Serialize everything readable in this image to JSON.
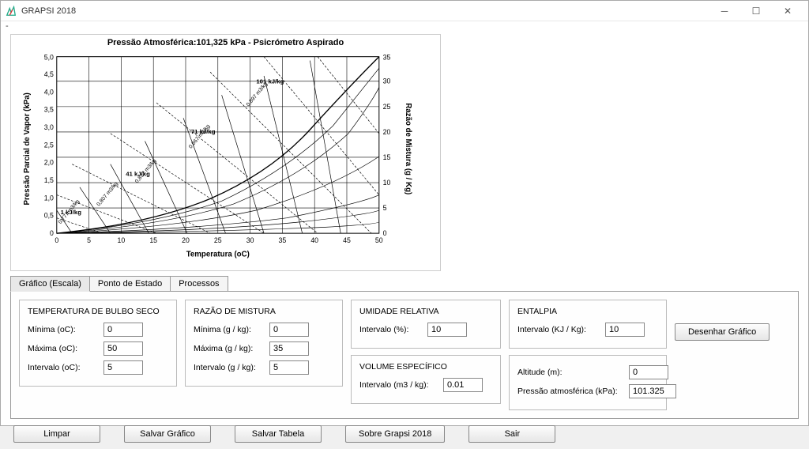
{
  "window": {
    "title": "GRAPSI 2018",
    "menubar_item": "-"
  },
  "chart_data": {
    "type": "area",
    "title": "Pressão Atmosférica:101,325 kPa - Psicrómetro Aspirado",
    "xlabel": "Temperatura (oC)",
    "ylabel_left": "Pressão Parcial de Vapor (kPa)",
    "ylabel_right": "Razão de Mistura (g / Kg)",
    "x_ticks": [
      0,
      5,
      10,
      15,
      20,
      25,
      30,
      35,
      40,
      45,
      50
    ],
    "y_left_ticks": [
      0,
      0.5,
      1.0,
      1.5,
      2.0,
      2.5,
      3.0,
      3.5,
      4.0,
      4.5,
      5.0
    ],
    "y_right_ticks": [
      0,
      5,
      10,
      15,
      20,
      25,
      30,
      35
    ],
    "enthalpy_lines_kJ_per_kg": [
      1,
      41,
      71,
      101
    ],
    "specific_volume_lines_m3_per_kg": [
      0.777,
      0.807,
      0.837,
      0.867,
      0.897
    ],
    "relative_humidity_lines_pct": [
      10,
      20,
      30,
      40,
      50,
      60,
      70,
      80,
      90,
      100
    ],
    "xlim": [
      0,
      50
    ],
    "ylim_left": [
      0,
      5.0
    ],
    "ylim_right": [
      0,
      35
    ]
  },
  "tabs": {
    "items": [
      {
        "label": "Gráfico (Escala)",
        "active": true
      },
      {
        "label": "Ponto de Estado",
        "active": false
      },
      {
        "label": "Processos",
        "active": false
      }
    ]
  },
  "groups": {
    "bulbo_seco": {
      "title": "TEMPERATURA DE BULBO SECO",
      "minima_label": "Mínima (oC):",
      "minima_value": "0",
      "maxima_label": "Máxima (oC):",
      "maxima_value": "50",
      "intervalo_label": "Intervalo (oC):",
      "intervalo_value": "5"
    },
    "razao_mistura": {
      "title": "RAZÃO DE MISTURA",
      "minima_label": "Mínima (g / kg):",
      "minima_value": "0",
      "maxima_label": "Máxima (g / kg):",
      "maxima_value": "35",
      "intervalo_label": "Intervalo (g / kg):",
      "intervalo_value": "5"
    },
    "umidade": {
      "title": "UMIDADE RELATIVA",
      "intervalo_label": "Intervalo (%):",
      "intervalo_value": "10"
    },
    "volume": {
      "title": "VOLUME ESPECÍFICO",
      "intervalo_label": "Intervalo (m3 / kg):",
      "intervalo_value": "0.01"
    },
    "entalpia": {
      "title": "ENTALPIA",
      "intervalo_label": "Intervalo (KJ / Kg):",
      "intervalo_value": "10"
    },
    "altitude": {
      "altitude_label": "Altitude (m):",
      "altitude_value": "0",
      "pressao_label": "Pressão atmosférica (kPa):",
      "pressao_value": "101.325"
    }
  },
  "buttons": {
    "desenhar": "Desenhar Gráfico",
    "limpar": "Limpar",
    "salvar_grafico": "Salvar Gráfico",
    "salvar_tabela": "Salvar Tabela",
    "sobre": "Sobre Grapsi 2018",
    "sair": "Sair"
  }
}
